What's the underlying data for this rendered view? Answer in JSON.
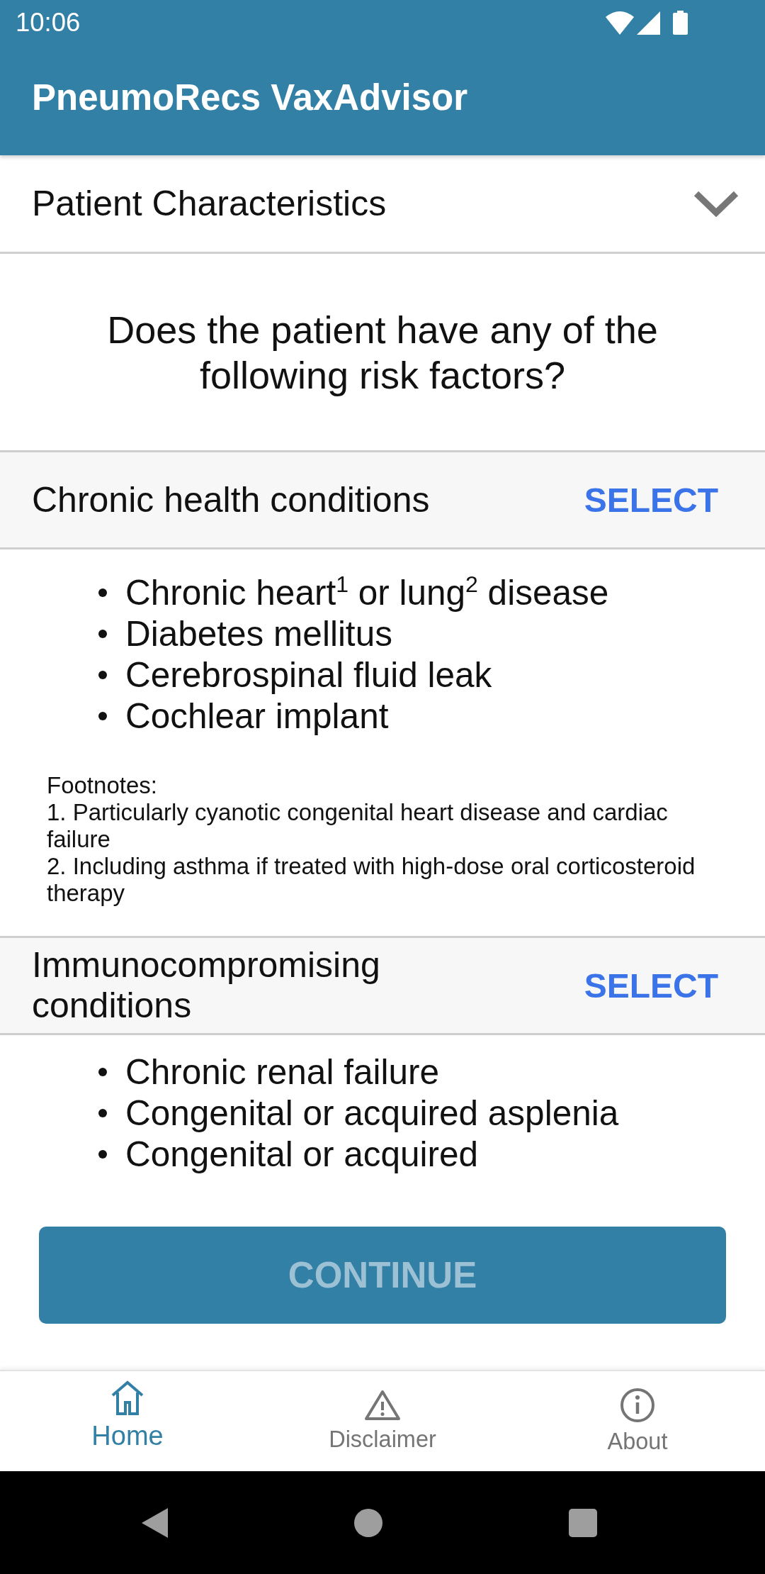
{
  "status_bar": {
    "time": "10:06"
  },
  "app_bar": {
    "title": "PneumoRecs VaxAdvisor"
  },
  "accordion": {
    "title": "Patient Characteristics",
    "expanded": false
  },
  "question": "Does the patient have any of the following risk factors?",
  "sections": [
    {
      "title": "Chronic health conditions",
      "action": "SELECT",
      "items": [
        "Chronic heart$^{1}$ or lung$^{2}$ disease",
        "Diabetes mellitus",
        "Cerebrospinal fluid leak",
        "Cochlear implant"
      ],
      "footnotes_label": "Footnotes:",
      "footnotes": [
        "1. Particularly cyanotic congenital heart disease and cardiac failure",
        "2. Including asthma if treated with high-dose oral corticosteroid therapy"
      ]
    },
    {
      "title": "Immunocompromising conditions",
      "action": "SELECT",
      "items": [
        "Chronic renal failure",
        "Congenital or acquired asplenia",
        "Congenital or acquired"
      ]
    }
  ],
  "continue_button": {
    "label": "CONTINUE",
    "disabled": true
  },
  "bottom_nav": [
    {
      "label": "Home",
      "selected": true
    },
    {
      "label": "Disclaimer",
      "selected": false
    },
    {
      "label": "About",
      "selected": false
    }
  ]
}
